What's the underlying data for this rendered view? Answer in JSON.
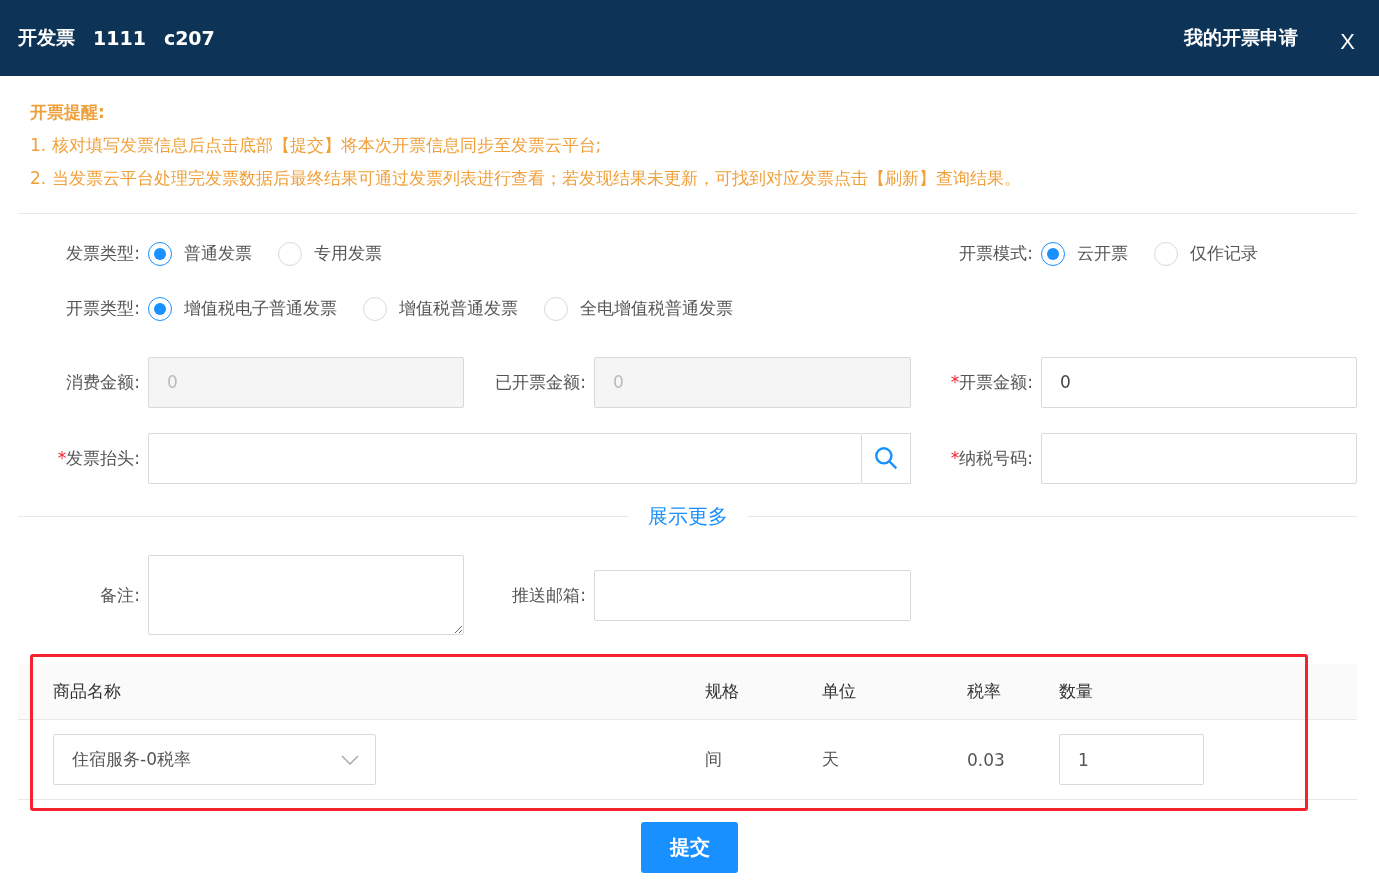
{
  "header": {
    "title": "开发票",
    "order_no": "1111",
    "room": "c207",
    "link": "我的开票申请",
    "close": "X"
  },
  "notice": {
    "title": "开票提醒:",
    "lines": [
      "1. 核对填写发票信息后点击底部【提交】将本次开票信息同步至发票云平台;",
      "2. 当发票云平台处理完发票数据后最终结果可通过发票列表进行查看；若发现结果未更新，可找到对应发票点击【刷新】查询结果。"
    ]
  },
  "radio_rows": [
    {
      "groups": [
        {
          "label": "发票类型:",
          "options": [
            {
              "label": "普通发票",
              "selected": true
            },
            {
              "label": "专用发票",
              "selected": false
            }
          ]
        },
        {
          "label": "开票模式:",
          "options": [
            {
              "label": "云开票",
              "selected": true
            },
            {
              "label": "仅作记录",
              "selected": false
            }
          ]
        }
      ]
    },
    {
      "groups": [
        {
          "label": "开票类型:",
          "options": [
            {
              "label": "增值税电子普通发票",
              "selected": true
            },
            {
              "label": "增值税普通发票",
              "selected": false
            },
            {
              "label": "全电增值税普通发票",
              "selected": false
            }
          ]
        }
      ]
    }
  ],
  "field_rows": [
    {
      "fields": [
        {
          "label": "消费金额:",
          "value": "0",
          "disabled": true,
          "kind": "text"
        },
        {
          "label": "已开票金额:",
          "value": "0",
          "disabled": true,
          "kind": "text"
        },
        {
          "label": "开票金额:",
          "required_mark": "*",
          "value": "0",
          "kind": "text"
        }
      ]
    },
    {
      "fields": [
        {
          "label": "发票抬头:",
          "required_mark": "*",
          "kind": "search"
        },
        {
          "label": "纳税号码:",
          "required_mark": "*",
          "kind": "text"
        }
      ]
    }
  ],
  "show_more": "展示更多",
  "extra_fields": [
    {
      "label": "备注:",
      "kind": "textarea"
    },
    {
      "label": "推送邮箱:",
      "kind": "text"
    }
  ],
  "table": {
    "columns": [
      "商品名称",
      "规格",
      "单位",
      "税率",
      "数量"
    ],
    "rows": [
      {
        "product": "住宿服务-0税率",
        "spec": "间",
        "unit": "天",
        "rate": "0.03",
        "quantity": "1"
      }
    ]
  },
  "submit": "提交"
}
